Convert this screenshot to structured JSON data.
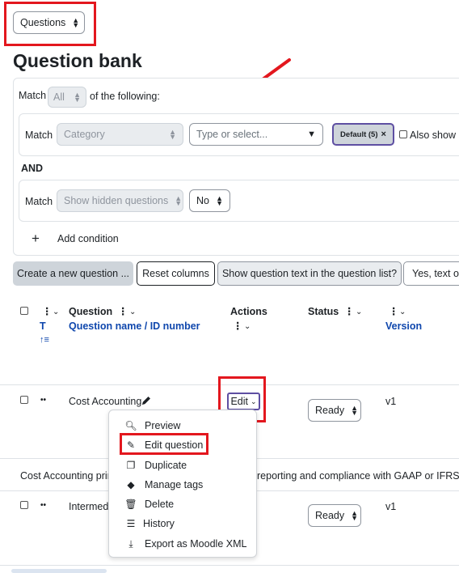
{
  "top": {
    "questions_select": "Questions"
  },
  "page_title": "Question bank",
  "filter": {
    "match_label": "Match",
    "all_select": "All",
    "of_following": "of the following:",
    "cond1": {
      "match_label": "Match",
      "category_select": "Category",
      "type_placeholder": "Type or select...",
      "chip_label": "Default (5)",
      "chip_remove": "×",
      "also_show": "Also show o"
    },
    "and_label": "AND",
    "cond2": {
      "match_label": "Match",
      "hidden_select": "Show hidden questions",
      "value_select": "No"
    },
    "add_condition_icon": "+",
    "add_condition": "Add condition"
  },
  "toolbar": {
    "create_new": "Create a new question ...",
    "reset_columns": "Reset columns",
    "show_text": "Show question text in the question list?",
    "yes_text": "Yes, text or"
  },
  "table": {
    "headers": {
      "t_label": "T",
      "sort_icon": "↑≡",
      "question_label": "Question",
      "question_name_link": "Question name / ID number",
      "actions_label": "Actions",
      "status_label": "Status",
      "version_label": "Version"
    },
    "rows": [
      {
        "drag": "••",
        "name": "Cost Accounting",
        "edit": "Edit",
        "status": "Ready",
        "version": "v1"
      },
      {
        "drag": "••",
        "name": "Intermedi",
        "status": "Ready",
        "version": "v1"
      }
    ],
    "row1_desc_left": "Cost Accounting prin",
    "row1_desc_right": "reporting and compliance with GAAP or IFRS."
  },
  "action_menu": {
    "items": [
      {
        "label": "Preview",
        "icon": "zoom-icon"
      },
      {
        "label": "Edit question",
        "icon": "pencil-icon"
      },
      {
        "label": "Duplicate",
        "icon": "copy-icon"
      },
      {
        "label": "Manage tags",
        "icon": "tag-icon"
      },
      {
        "label": "Delete",
        "icon": "trash-icon"
      },
      {
        "label": "History",
        "icon": "history-icon"
      },
      {
        "label": "Export as Moodle XML",
        "icon": "download-icon"
      }
    ]
  },
  "colors": {
    "annotation_red": "#e3171e",
    "link_blue": "#0f47ad",
    "chip_border": "#5e4fa2",
    "button_grey": "#ced4da"
  }
}
